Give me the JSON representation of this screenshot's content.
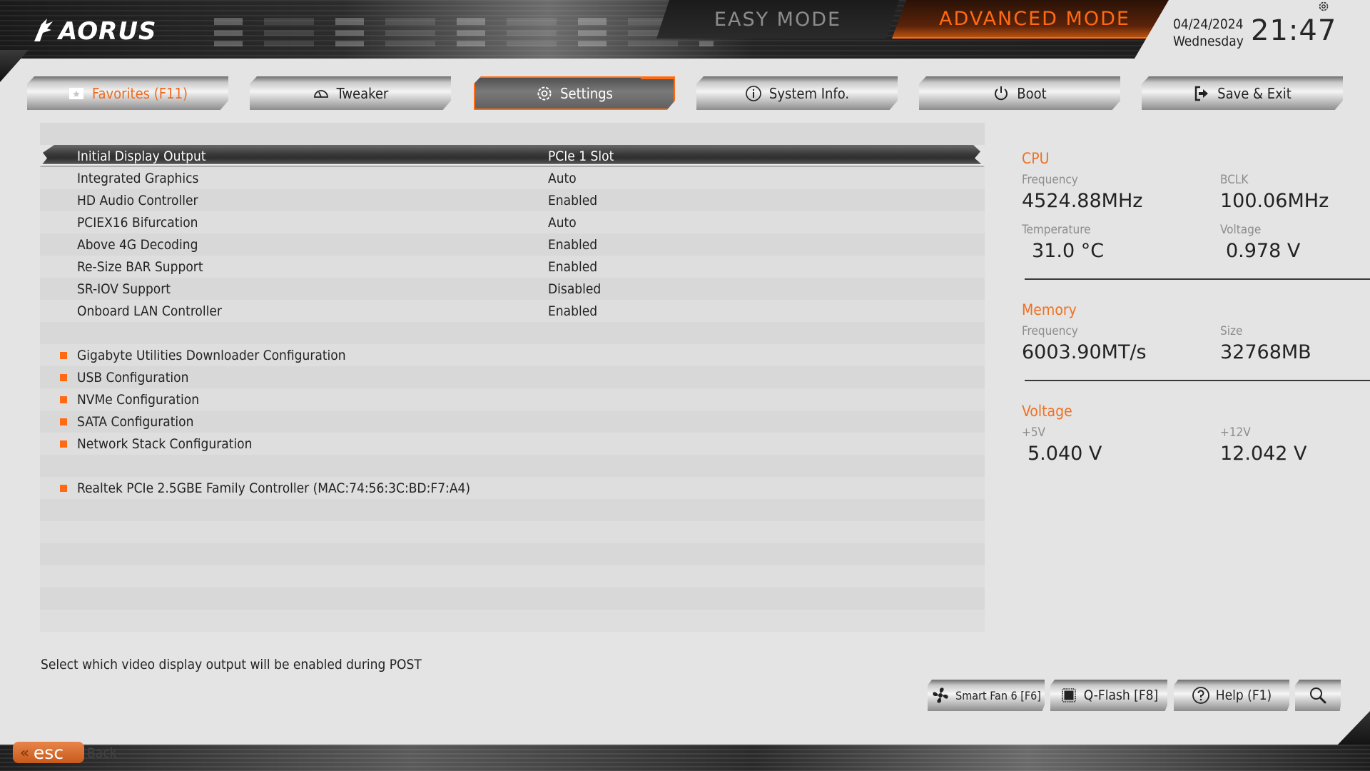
{
  "brand": {
    "logo_text": "AORUS"
  },
  "modes": {
    "easy": "EASY MODE",
    "advanced": "ADVANCED MODE",
    "active": "advanced"
  },
  "clock": {
    "date": "04/24/2024",
    "weekday": "Wednesday",
    "time": "21:47"
  },
  "colors": {
    "accent": "#ff6a13",
    "section_title": "#f07020",
    "background": "#e4e4e4"
  },
  "tabs": [
    {
      "label": "Favorites (F11)",
      "icon": "favorites-star-icon",
      "active": false
    },
    {
      "label": "Tweaker",
      "icon": "speedometer-icon",
      "active": false
    },
    {
      "label": "Settings",
      "icon": "gear-icon",
      "active": true
    },
    {
      "label": "System Info.",
      "icon": "info-icon",
      "active": false
    },
    {
      "label": "Boot",
      "icon": "power-icon",
      "active": false
    },
    {
      "label": "Save & Exit",
      "icon": "exit-icon",
      "active": false
    }
  ],
  "settings": {
    "options": [
      {
        "label": "Initial Display Output",
        "value": "PCIe 1 Slot",
        "selected": true
      },
      {
        "label": "Integrated Graphics",
        "value": "Auto"
      },
      {
        "label": "HD Audio Controller",
        "value": "Enabled"
      },
      {
        "label": "PCIEX16 Bifurcation",
        "value": "Auto"
      },
      {
        "label": "Above 4G Decoding",
        "value": "Enabled"
      },
      {
        "label": "Re-Size BAR Support",
        "value": "Enabled"
      },
      {
        "label": "SR-IOV Support",
        "value": "Disabled"
      },
      {
        "label": "Onboard LAN Controller",
        "value": "Enabled"
      }
    ],
    "submenus": [
      {
        "label": "Gigabyte Utilities Downloader Configuration"
      },
      {
        "label": "USB Configuration"
      },
      {
        "label": "NVMe Configuration"
      },
      {
        "label": "SATA Configuration"
      },
      {
        "label": "Network Stack Configuration"
      }
    ],
    "network_devices": [
      {
        "label": "Realtek PCIe 2.5GBE Family Controller (MAC:74:56:3C:BD:F7:A4)"
      }
    ]
  },
  "info": {
    "cpu": {
      "title": "CPU",
      "frequency_label": "Frequency",
      "frequency": "4524.88MHz",
      "bclk_label": "BCLK",
      "bclk": "100.06MHz",
      "temperature_label": "Temperature",
      "temperature": "31.0 °C",
      "voltage_label": "Voltage",
      "voltage": "0.978 V"
    },
    "memory": {
      "title": "Memory",
      "frequency_label": "Frequency",
      "frequency": "6003.90MT/s",
      "size_label": "Size",
      "size": "32768MB"
    },
    "voltage": {
      "title": "Voltage",
      "v5_label": "+5V",
      "v5": "5.040 V",
      "v12_label": "+12V",
      "v12": "12.042 V"
    }
  },
  "help_text": "Select which video display output will be enabled during POST",
  "bottom_buttons": [
    {
      "label": "Smart Fan 6 [F6]",
      "icon": "fan-icon"
    },
    {
      "label": "Q-Flash [F8]",
      "icon": "chip-icon"
    },
    {
      "label": "Help (F1)",
      "icon": "help-icon"
    },
    {
      "label": "",
      "icon": "search-icon"
    }
  ],
  "footer": {
    "esc_label": "esc",
    "esc_action": "Back"
  }
}
